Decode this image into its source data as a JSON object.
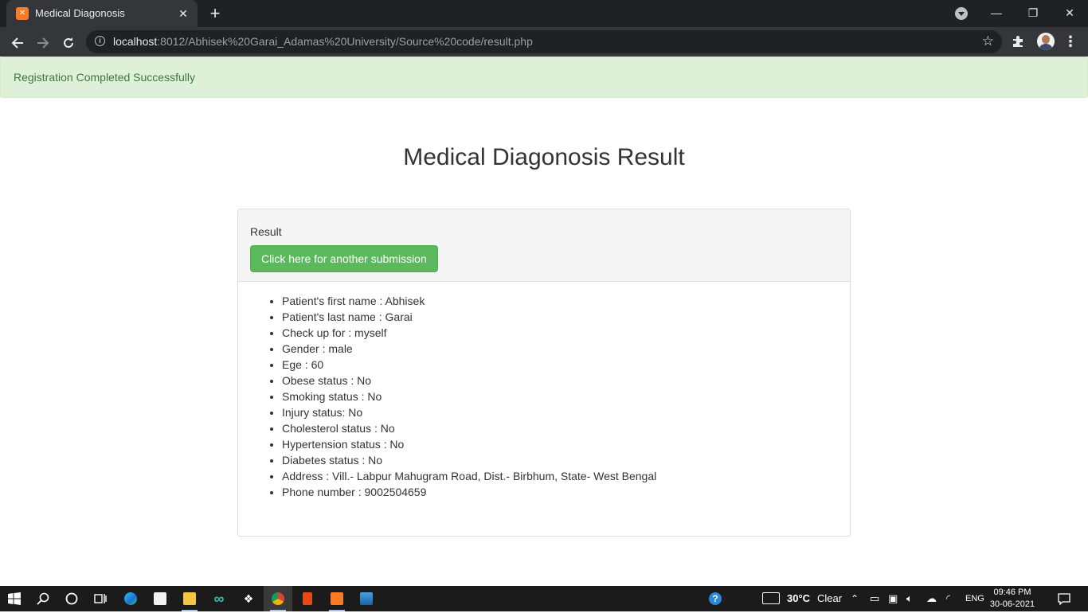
{
  "browser": {
    "tab_title": "Medical Diagonosis",
    "tab_close": "✕",
    "new_tab": "+",
    "url_host": "localhost",
    "url_rest": ":8012/Abhisek%20Garai_Adamas%20University/Source%20code/result.php",
    "window_controls": {
      "minimize": "—",
      "restore": "❐",
      "close": "✕"
    }
  },
  "alert": {
    "text": "Registration Completed Successfully",
    "color": "#3c763d",
    "background": "#dff0d8"
  },
  "page": {
    "title": "Medical Diagonosis Result"
  },
  "panel": {
    "heading": "Result",
    "button_label": "Click here for another submission",
    "button_color": "#5cb85c",
    "items": [
      "Patient's first name : Abhisek",
      "Patient's last name : Garai",
      "Check up for : myself",
      "Gender : male",
      "Ege : 60",
      "Obese status : No",
      "Smoking status : No",
      "Injury status: No",
      "Cholesterol status : No",
      "Hypertension status : No",
      "Diabetes status : No",
      "Address : Vill.- Labpur Mahugram Road, Dist.- Birbhum, State- West Bengal",
      "Phone number : 9002504659"
    ]
  },
  "taskbar": {
    "apps": [
      "start-icon",
      "search-icon",
      "cortana-icon",
      "task-view-icon",
      "edge-icon",
      "store-icon",
      "file-explorer-icon",
      "arduino-icon",
      "dropbox-icon",
      "chrome-icon",
      "office-icon",
      "xampp-icon",
      "photos-icon"
    ],
    "weather_temp": "30°C",
    "weather_text": "Clear",
    "language": "ENG",
    "time": "09:46 PM",
    "date": "30-06-2021"
  }
}
